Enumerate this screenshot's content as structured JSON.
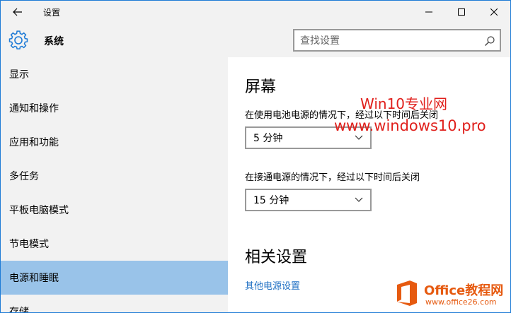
{
  "window": {
    "title": "设置",
    "header_title": "系统"
  },
  "search": {
    "placeholder": "查找设置",
    "value": ""
  },
  "sidebar": {
    "items": [
      {
        "label": "显示",
        "selected": false
      },
      {
        "label": "通知和操作",
        "selected": false
      },
      {
        "label": "应用和功能",
        "selected": false
      },
      {
        "label": "多任务",
        "selected": false
      },
      {
        "label": "平板电脑模式",
        "selected": false
      },
      {
        "label": "节电模式",
        "selected": false
      },
      {
        "label": "电源和睡眠",
        "selected": true
      },
      {
        "label": "存储",
        "selected": false
      }
    ]
  },
  "content": {
    "screen_title": "屏幕",
    "battery_label": "在使用电池电源的情况下，经过以下时间后关闭",
    "battery_value": "5 分钟",
    "plugged_label": "在接通电源的情况下，经过以下时间后关闭",
    "plugged_value": "15 分钟",
    "related_title": "相关设置",
    "related_link": "其他电源设置"
  },
  "watermarks": {
    "site_name": "Win10专业网",
    "site_url": "www.windows10.pro",
    "office_brand": "Office教程网",
    "office_url": "www.office26.com"
  },
  "colors": {
    "accent": "#1e7bd6",
    "selected_bg": "#99c3e9",
    "link": "#1f6fc3",
    "watermark_red": "#e0201c",
    "office_orange": "#e65a10"
  }
}
